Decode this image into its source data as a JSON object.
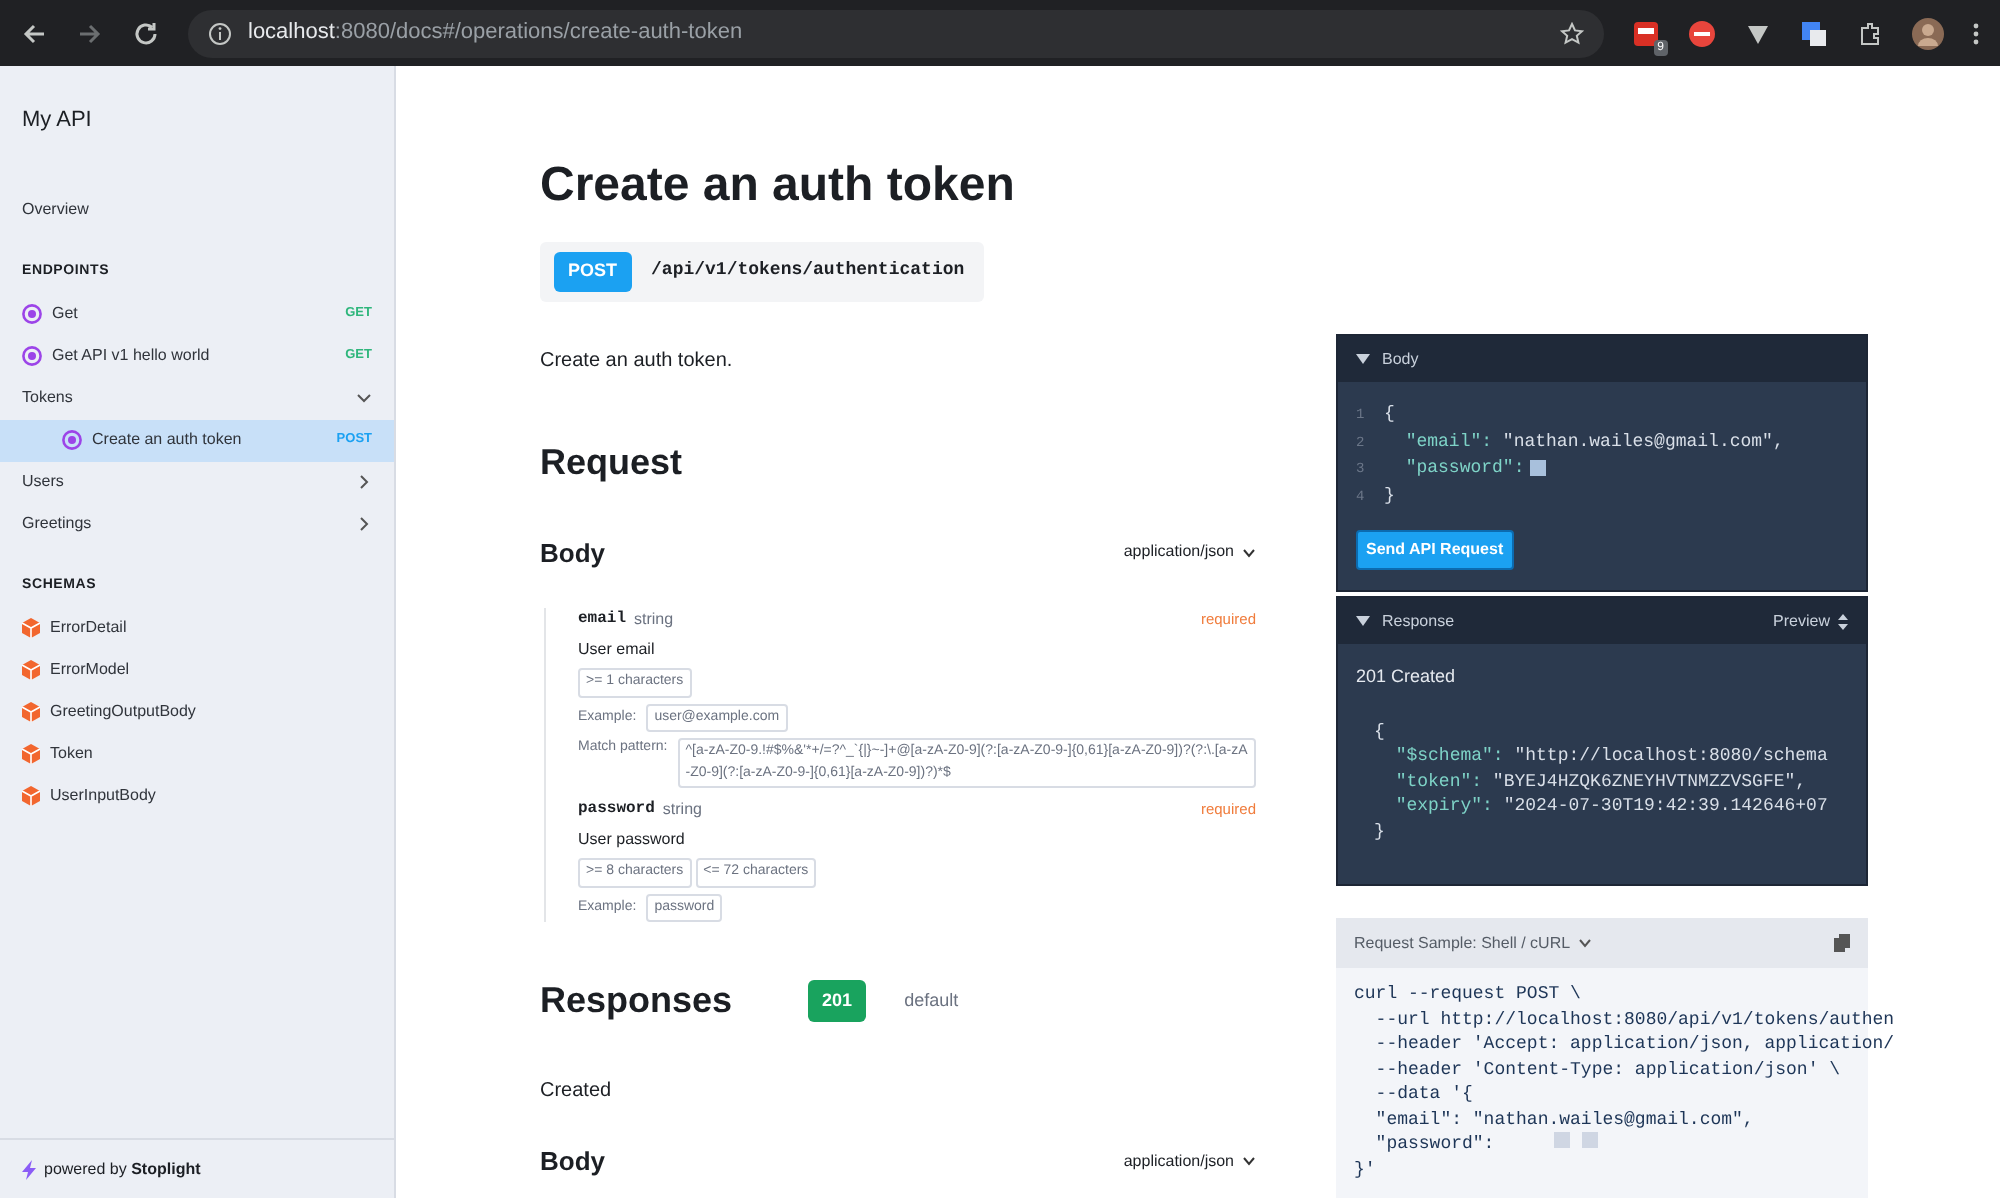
{
  "browser": {
    "url_host": "localhost",
    "url_path": ":8080/docs#/operations/create-auth-token",
    "extension_badge": "9"
  },
  "sidebar": {
    "title": "My API",
    "items": [
      {
        "kind": "link",
        "label": "Overview",
        "selected": false
      },
      {
        "kind": "heading",
        "label": "ENDPOINTS"
      },
      {
        "kind": "endpoint",
        "label": "Get",
        "method": "GET",
        "selected": false
      },
      {
        "kind": "endpoint",
        "label": "Get API v1 hello world",
        "method": "GET",
        "selected": false
      },
      {
        "kind": "group",
        "label": "Tokens",
        "expanded": true,
        "children": [
          {
            "kind": "endpoint",
            "label": "Create an auth token",
            "method": "POST",
            "selected": true
          }
        ]
      },
      {
        "kind": "group",
        "label": "Users",
        "expanded": false
      },
      {
        "kind": "group",
        "label": "Greetings",
        "expanded": false
      },
      {
        "kind": "heading",
        "label": "SCHEMAS"
      },
      {
        "kind": "schema",
        "label": "ErrorDetail",
        "selected": false
      },
      {
        "kind": "schema",
        "label": "ErrorModel",
        "selected": false
      },
      {
        "kind": "schema",
        "label": "GreetingOutputBody",
        "selected": false
      },
      {
        "kind": "schema",
        "label": "Token",
        "selected": false
      },
      {
        "kind": "schema",
        "label": "UserInputBody",
        "selected": false
      }
    ],
    "footer_prefix": "powered by",
    "footer_brand": "Stoplight"
  },
  "operation": {
    "title": "Create an auth token",
    "method": "POST",
    "path": "/api/v1/tokens/authentication",
    "description": "Create an auth token.",
    "request": {
      "heading": "Request",
      "body_label": "Body",
      "content_type": "application/json",
      "fields": [
        {
          "name": "email",
          "type": "string",
          "required": "required",
          "description": "User email",
          "constraints": [
            ">= 1 characters"
          ],
          "example_label": "Example:",
          "example": "user@example.com",
          "pattern_label": "Match pattern:",
          "pattern": "^[a-zA-Z0-9.!#$%&'*+/=?^_`{|}~-]+@[a-zA-Z0-9](?:[a-zA-Z0-9-]{0,61}[a-zA-Z0-9])?(?:\\.[a-zA-Z0-9](?:[a-zA-Z0-9-]{0,61}[a-zA-Z0-9])?)*$"
        },
        {
          "name": "password",
          "type": "string",
          "required": "required",
          "description": "User password",
          "constraints": [
            ">= 8 characters",
            "<= 72 characters"
          ],
          "example_label": "Example:",
          "example": "password"
        }
      ]
    },
    "responses": {
      "heading": "Responses",
      "codes": [
        {
          "label": "201",
          "selected": true
        },
        {
          "label": "default",
          "selected": false
        }
      ],
      "description": "Created",
      "body_label": "Body",
      "content_type": "application/json"
    }
  },
  "try_it": {
    "body_title": "Body",
    "body_lines": [
      {
        "number": "1",
        "text": "{"
      },
      {
        "number": "2",
        "key": "\"email\":",
        "value": "\"nathan.wailes@gmail.com\","
      },
      {
        "number": "3",
        "key": "\"password\":",
        "redacted": true
      },
      {
        "number": "4",
        "text": "}"
      }
    ],
    "send_button": "Send API Request",
    "response_title": "Response",
    "response_view": "Preview",
    "status": "201 Created",
    "response_lines": [
      {
        "text": "{"
      },
      {
        "key": "\"$schema\":",
        "value": "\"http://localhost:8080/schema"
      },
      {
        "key": "\"token\":",
        "value": "\"BYEJ4HZQK6ZNEYHVTNMZZVSGFE\","
      },
      {
        "key": "\"expiry\":",
        "value": "\"2024-07-30T19:42:39.142646+07"
      },
      {
        "text": "}"
      }
    ]
  },
  "sample": {
    "title": "Request Sample: Shell / cURL",
    "lines": [
      {
        "text": "curl --request POST \\"
      },
      {
        "text": "  --url http://localhost:8080/api/v1/tokens/authen"
      },
      {
        "text": "  --header 'Accept: application/json, application/"
      },
      {
        "text": "  --header 'Content-Type: application/json' \\"
      },
      {
        "text": "  --data '{"
      },
      {
        "text": "  \"email\": \"nathan.wailes@gmail.com\","
      },
      {
        "text": "  \"password\":",
        "redacted": true
      },
      {
        "text": "}'"
      }
    ]
  }
}
